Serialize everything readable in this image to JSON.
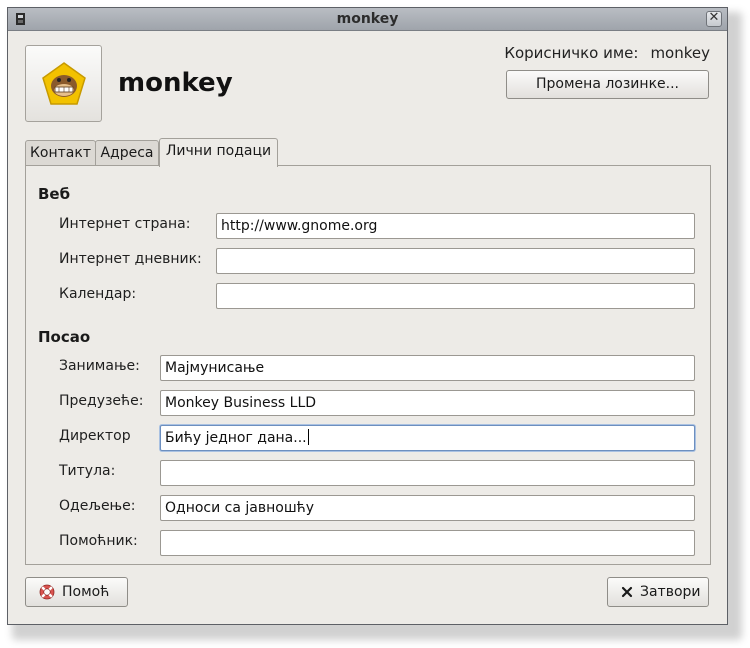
{
  "window": {
    "title": "monkey"
  },
  "header": {
    "display_name": "monkey",
    "username_label": "Корисничко име:",
    "username_value": "monkey",
    "change_password_label": "Промена лозинке..."
  },
  "tabs": [
    {
      "label": "Контакт",
      "active": false
    },
    {
      "label": "Адреса",
      "active": false
    },
    {
      "label": "Лични подаци",
      "active": true
    }
  ],
  "web": {
    "heading": "Веб",
    "homepage_label": "Интернет страна:",
    "homepage_value": "http://www.gnome.org",
    "blog_label": "Интернет дневник:",
    "blog_value": "",
    "calendar_label": "Календар:",
    "calendar_value": ""
  },
  "job": {
    "heading": "Посао",
    "occupation_label": "Занимање:",
    "occupation_value": "Мајмунисање",
    "company_label": "Предузеће:",
    "company_value": "Monkey Business LLD",
    "manager_label": "Директор",
    "manager_value": "Бићу једног дана...",
    "title_label": "Титула:",
    "title_value": "",
    "department_label": "Одељење:",
    "department_value": "Односи са јавношћу",
    "assistant_label": "Помоћник:",
    "assistant_value": ""
  },
  "footer": {
    "help_label": "Помоћ",
    "close_label": "Затвори"
  },
  "colors": {
    "avatar_badge": "#f2c200",
    "focus_ring": "#6d8fbf"
  },
  "icons": [
    "window-menu-icon",
    "window-close-icon",
    "monkey-avatar-icon",
    "help-lifebuoy-icon",
    "close-x-icon"
  ]
}
